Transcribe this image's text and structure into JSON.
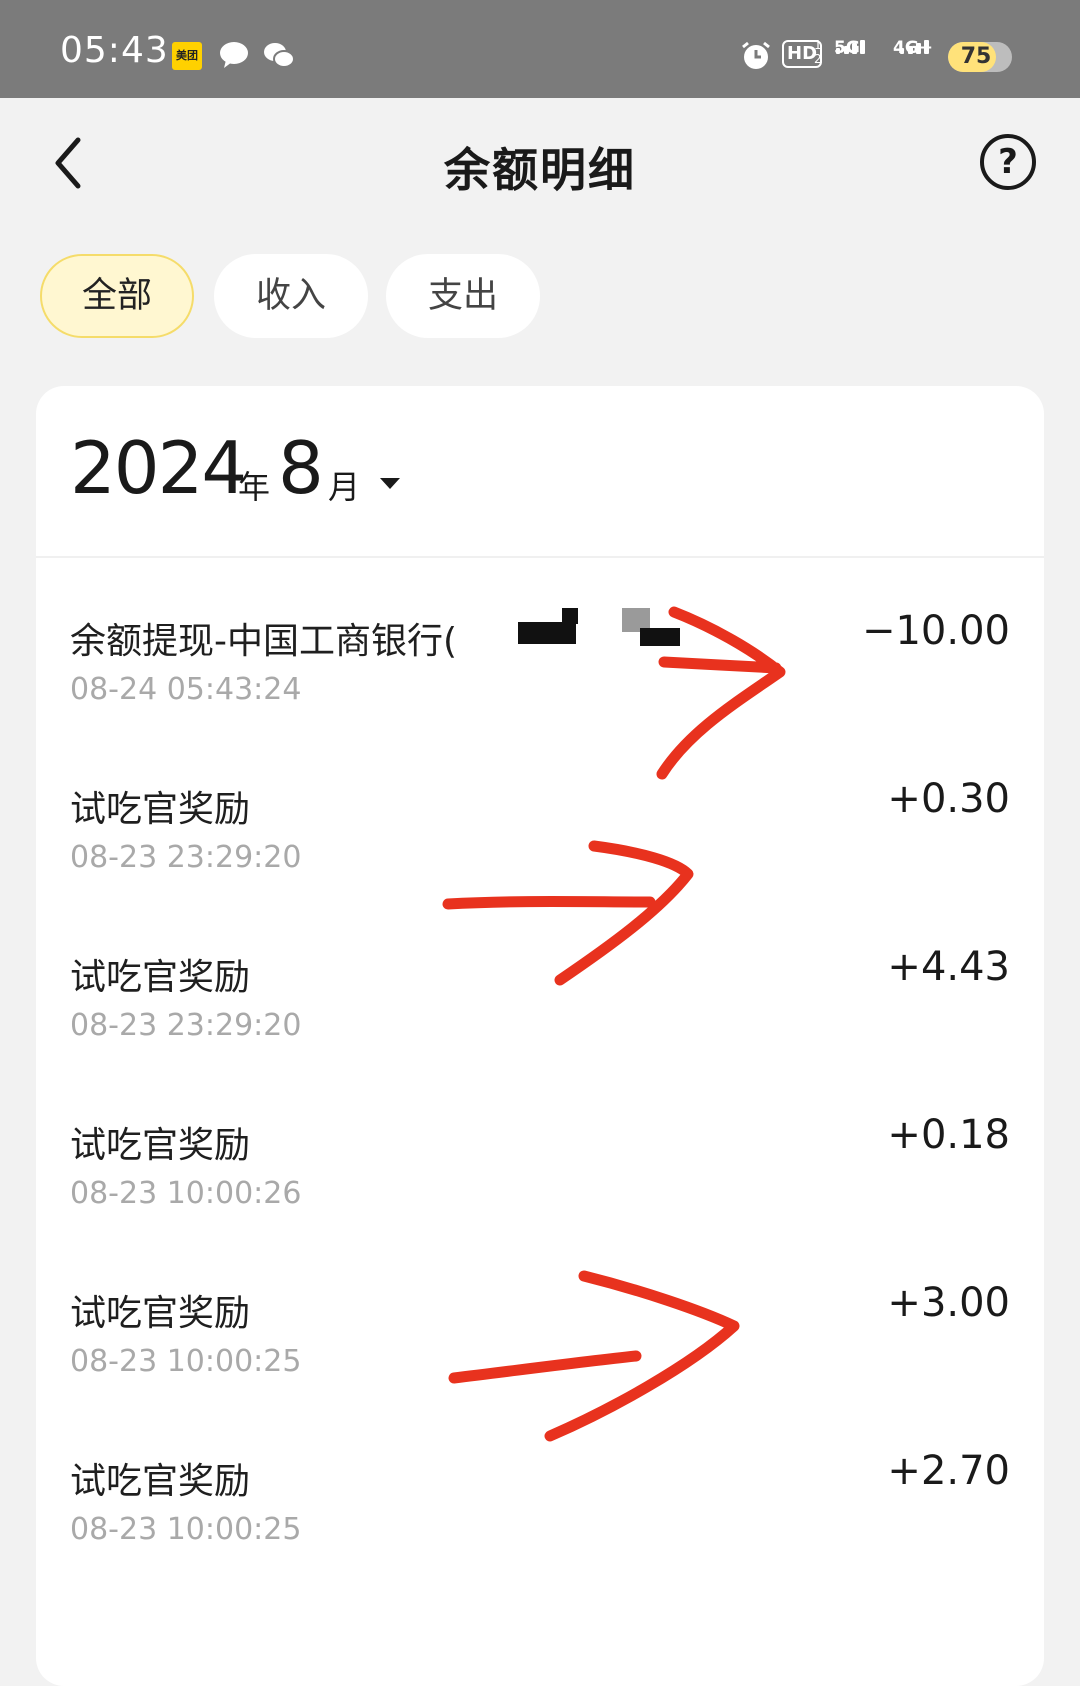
{
  "status_bar": {
    "time": "05:43",
    "meituan_badge": "美团",
    "hd_label": "HD",
    "hd_sub": "1\n2",
    "net1": "5G",
    "net2": "4G+",
    "battery_level": 75,
    "battery_text": "75",
    "icons": [
      "chat-bubble-icon",
      "wechat-icon",
      "alarm-icon"
    ]
  },
  "header": {
    "title": "余额明细",
    "back_icon": "chevron-left-icon",
    "help_icon": "question-circle-icon",
    "help_glyph": "?"
  },
  "tabs": [
    {
      "label": "全部",
      "active": true
    },
    {
      "label": "收入",
      "active": false
    },
    {
      "label": "支出",
      "active": false
    }
  ],
  "month_selector": {
    "year": "2024",
    "year_unit": "年",
    "month": "8",
    "month_unit": "月",
    "icon": "caret-down-icon"
  },
  "transactions": [
    {
      "title": "余额提现-中国工商银行(",
      "time": "08-24 05:43:24",
      "amount": "−10.00"
    },
    {
      "title": "试吃官奖励",
      "time": "08-23 23:29:20",
      "amount": "+0.30"
    },
    {
      "title": "试吃官奖励",
      "time": "08-23 23:29:20",
      "amount": "+4.43"
    },
    {
      "title": "试吃官奖励",
      "time": "08-23 10:00:26",
      "amount": "+0.18"
    },
    {
      "title": "试吃官奖励",
      "time": "08-23 10:00:25",
      "amount": "+3.00"
    },
    {
      "title": "试吃官奖励",
      "time": "08-23 10:00:25",
      "amount": "+2.70"
    }
  ],
  "colors": {
    "status_bar_bg": "#7b7b7b",
    "page_bg": "#f2f2f2",
    "active_tab_bg": "#fff7d1",
    "active_tab_border": "#f5dc6a",
    "timestamp": "#a9a9a9",
    "annotation_red": "#e8321e",
    "battery_fill": "#ffe27a"
  }
}
